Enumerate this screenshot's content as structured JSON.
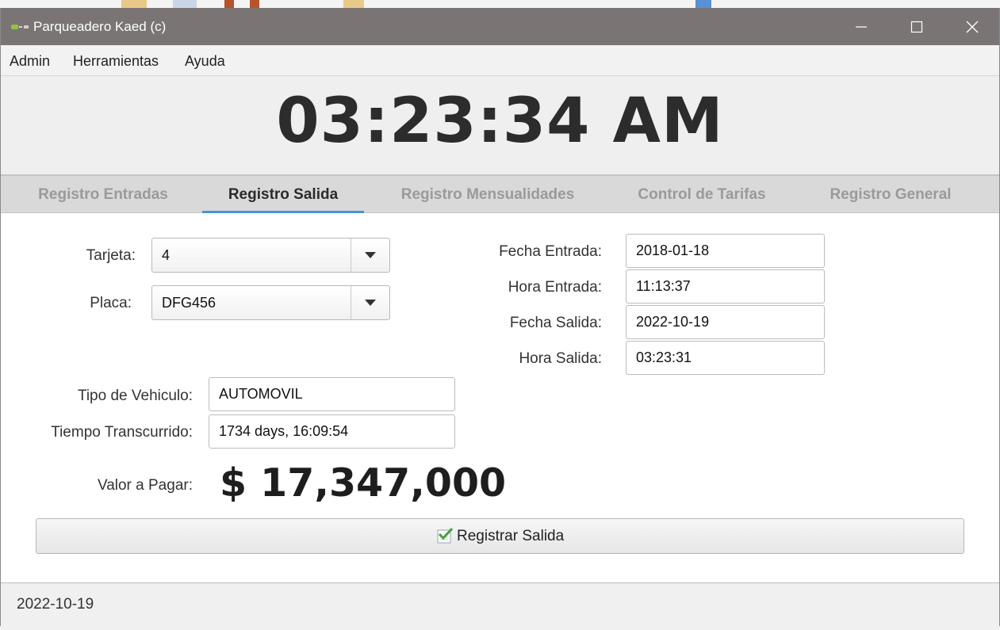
{
  "window": {
    "title": "Parqueadero Kaed (c)",
    "minimize_icon": "minimize-icon",
    "maximize_icon": "maximize-icon",
    "close_icon": "close-icon"
  },
  "menu": {
    "items": [
      "Admin",
      "Herramientas",
      "Ayuda"
    ]
  },
  "clock": {
    "time": "03:23:34 AM"
  },
  "tabs": [
    {
      "label": "Registro Entradas",
      "active": false
    },
    {
      "label": "Registro Salida",
      "active": true
    },
    {
      "label": "Registro Mensualidades",
      "active": false
    },
    {
      "label": "Control de Tarifas",
      "active": false
    },
    {
      "label": "Registro General",
      "active": false
    }
  ],
  "form": {
    "tarjeta": {
      "label": "Tarjeta:",
      "value": "4"
    },
    "placa": {
      "label": "Placa:",
      "value": "DFG456"
    },
    "tipo_vehiculo": {
      "label": "Tipo de Vehiculo:",
      "value": "AUTOMOVIL"
    },
    "tiempo": {
      "label": "Tiempo Transcurrido:",
      "value": "1734 days, 16:09:54"
    },
    "valor": {
      "label": "Valor a Pagar:",
      "value": "$ 17,347,000"
    },
    "fecha_entrada": {
      "label": "Fecha Entrada:",
      "value": "2018-01-18"
    },
    "hora_entrada": {
      "label": "Hora Entrada:",
      "value": "11:13:37"
    },
    "fecha_salida": {
      "label": "Fecha Salida:",
      "value": "2022-10-19"
    },
    "hora_salida": {
      "label": "Hora Salida:",
      "value": "03:23:31"
    }
  },
  "register_button": {
    "label": "Registrar Salida",
    "icon": "checkmark-icon"
  },
  "status": {
    "date": "2022-10-19"
  },
  "colors": {
    "titlebar": "#7a7574",
    "active_tab_underline": "#4a90d9",
    "tab_inactive_text": "#9a9a9a"
  }
}
